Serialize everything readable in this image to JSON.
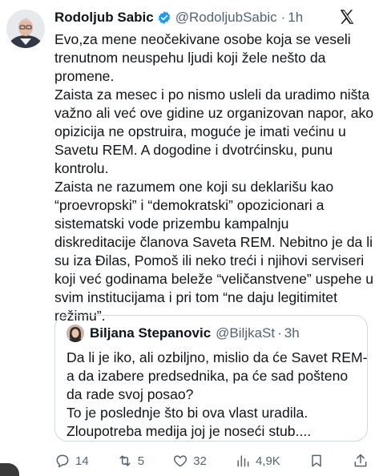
{
  "tweet": {
    "author_name": "Rodoljub Sabic",
    "handle": "@RodoljubSabic",
    "separator": "·",
    "time": "1h",
    "lines": [
      "Evo,za mene neočekivane osobe  koja se veseli",
      "trenutnom neuspehu ljudi koji žele nešto da",
      "promene.",
      "Zaista za mesec i po nismo usleli da uradimo ništa",
      "važno ali već ove gidine uz organizovan napor, ako",
      "opizicija ne opstruira, moguće je imati većinu u",
      "Savetu REM. A dogodine i dvotrćinsku, punu",
      "kontrolu.",
      "Zaista ne razumem one koji su deklarišu kao",
      "“proevropski” i “demokratski”  opozicionari a",
      "sistematski vode  prizembu kampalnju",
      "diskreditacije članova Saveta REM.  Nebitno je da li",
      "su iza Đilas, Pomoš ili neko treći i njihovi serviseri",
      "koji već godinama beleže “veličanstvene” uspehe u",
      "svim institucijama i pri tom “ne daju legitimitet",
      "režimu”."
    ]
  },
  "quote": {
    "author_name": "Biljana Stepanovic",
    "handle": "@BiljkaSt",
    "separator": "·",
    "time": "3h",
    "lines": [
      "Da li je iko, ali ozbiljno, mislio da će Savet REM-",
      "a da izabere predsednika, pa će sad pošteno",
      "da rade svoj posao?",
      "To je poslednje što bi ova vlast uradila.",
      "Zloupotreba medija joj je noseći stub...."
    ]
  },
  "actions": {
    "replies": "14",
    "reposts": "5",
    "likes": "32",
    "views": "4,9K"
  },
  "icons": {
    "verified": "verified-badge-icon",
    "logo": "x-logo-icon",
    "reply": "reply-icon",
    "repost": "repost-icon",
    "like": "like-icon",
    "views": "views-icon",
    "bookmark": "bookmark-icon",
    "share": "share-icon"
  },
  "colors": {
    "text": "#0f1419",
    "secondary": "#536471",
    "verified": "#1d9bf0",
    "border": "#cfd9de"
  }
}
